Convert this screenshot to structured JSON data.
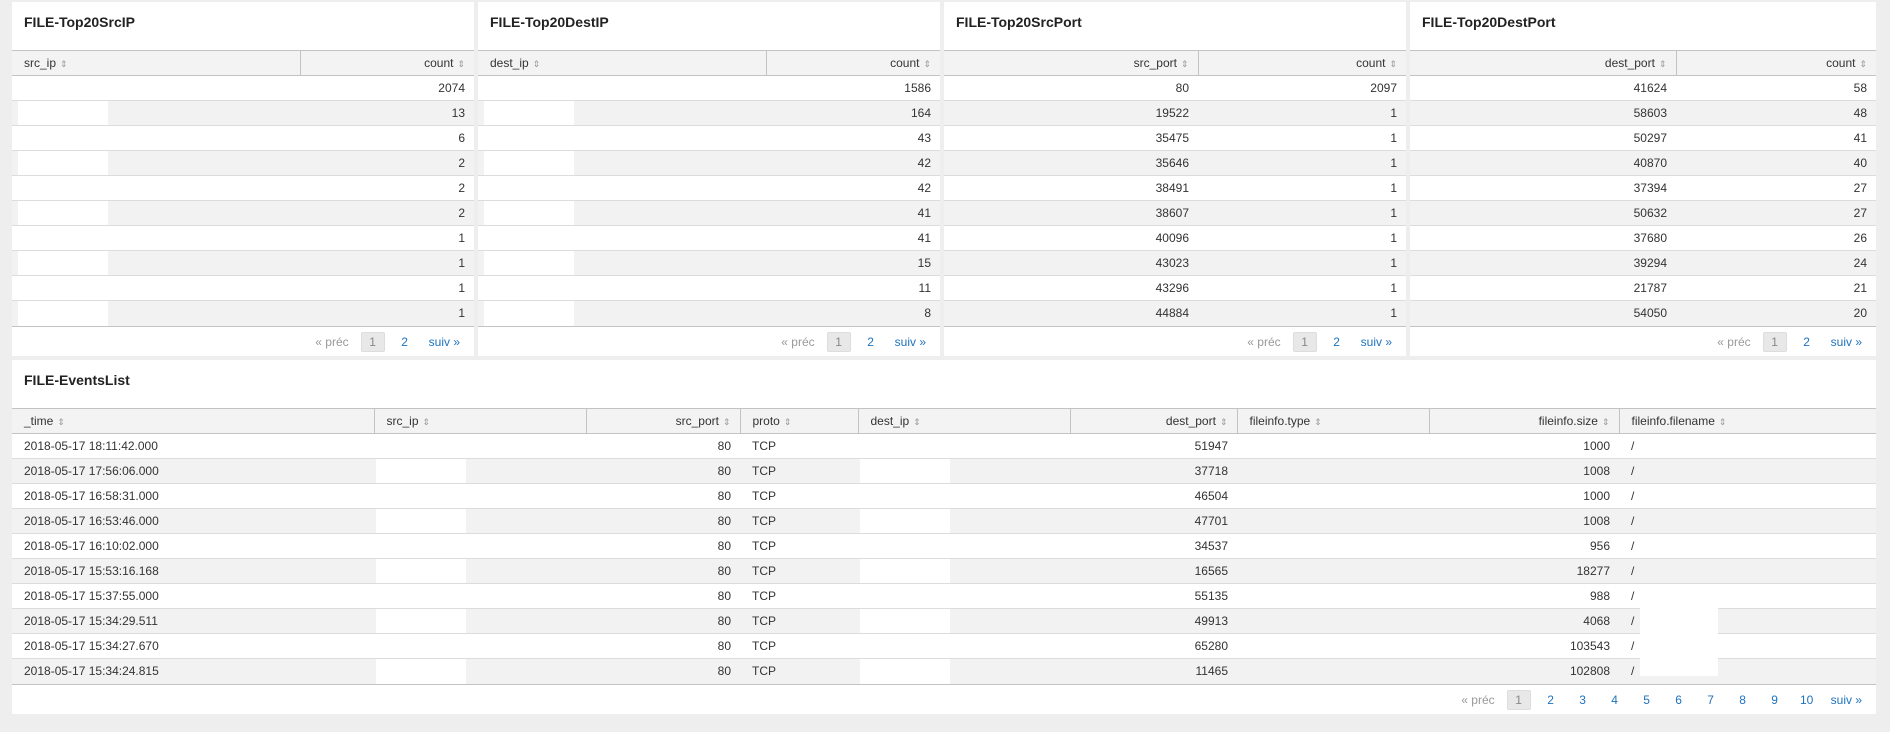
{
  "panels": {
    "srcip": {
      "title": "FILE-Top20SrcIP",
      "columns": [
        "src_ip",
        "count"
      ],
      "rows": [
        [
          "",
          "2074"
        ],
        [
          "",
          "13"
        ],
        [
          "",
          "6"
        ],
        [
          "",
          "2"
        ],
        [
          "",
          "2"
        ],
        [
          "",
          "2"
        ],
        [
          "",
          "1"
        ],
        [
          "",
          "1"
        ],
        [
          "",
          "1"
        ],
        [
          "",
          "1"
        ]
      ],
      "pager": {
        "prev": "« préc",
        "pages": [
          "1",
          "2"
        ],
        "next": "suiv »"
      }
    },
    "destip": {
      "title": "FILE-Top20DestIP",
      "columns": [
        "dest_ip",
        "count"
      ],
      "rows": [
        [
          "",
          "1586"
        ],
        [
          "",
          "164"
        ],
        [
          "",
          "43"
        ],
        [
          "",
          "42"
        ],
        [
          "",
          "42"
        ],
        [
          "",
          "41"
        ],
        [
          "",
          "41"
        ],
        [
          "",
          "15"
        ],
        [
          "",
          "11"
        ],
        [
          "",
          "8"
        ]
      ],
      "pager": {
        "prev": "« préc",
        "pages": [
          "1",
          "2"
        ],
        "next": "suiv »"
      }
    },
    "srcport": {
      "title": "FILE-Top20SrcPort",
      "columns": [
        "src_port",
        "count"
      ],
      "rows": [
        [
          "80",
          "2097"
        ],
        [
          "19522",
          "1"
        ],
        [
          "35475",
          "1"
        ],
        [
          "35646",
          "1"
        ],
        [
          "38491",
          "1"
        ],
        [
          "38607",
          "1"
        ],
        [
          "40096",
          "1"
        ],
        [
          "43023",
          "1"
        ],
        [
          "43296",
          "1"
        ],
        [
          "44884",
          "1"
        ]
      ],
      "pager": {
        "prev": "« préc",
        "pages": [
          "1",
          "2"
        ],
        "next": "suiv »"
      }
    },
    "destport": {
      "title": "FILE-Top20DestPort",
      "columns": [
        "dest_port",
        "count"
      ],
      "rows": [
        [
          "41624",
          "58"
        ],
        [
          "58603",
          "48"
        ],
        [
          "50297",
          "41"
        ],
        [
          "40870",
          "40"
        ],
        [
          "37394",
          "27"
        ],
        [
          "50632",
          "27"
        ],
        [
          "37680",
          "26"
        ],
        [
          "39294",
          "24"
        ],
        [
          "21787",
          "21"
        ],
        [
          "54050",
          "20"
        ]
      ],
      "pager": {
        "prev": "« préc",
        "pages": [
          "1",
          "2"
        ],
        "next": "suiv »"
      }
    },
    "events": {
      "title": "FILE-EventsList",
      "columns": [
        "_time",
        "src_ip",
        "src_port",
        "proto",
        "dest_ip",
        "dest_port",
        "fileinfo.type",
        "fileinfo.size",
        "fileinfo.filename"
      ],
      "rows": [
        [
          "2018-05-17 18:11:42.000",
          "",
          "80",
          "TCP",
          "",
          "51947",
          "",
          "1000",
          "/"
        ],
        [
          "2018-05-17 17:56:06.000",
          "",
          "80",
          "TCP",
          "",
          "37718",
          "",
          "1008",
          "/"
        ],
        [
          "2018-05-17 16:58:31.000",
          "",
          "80",
          "TCP",
          "",
          "46504",
          "",
          "1000",
          "/"
        ],
        [
          "2018-05-17 16:53:46.000",
          "",
          "80",
          "TCP",
          "",
          "47701",
          "",
          "1008",
          "/"
        ],
        [
          "2018-05-17 16:10:02.000",
          "",
          "80",
          "TCP",
          "",
          "34537",
          "",
          "956",
          "/"
        ],
        [
          "2018-05-17 15:53:16.168",
          "",
          "80",
          "TCP",
          "",
          "16565",
          "",
          "18277",
          "/"
        ],
        [
          "2018-05-17 15:37:55.000",
          "",
          "80",
          "TCP",
          "",
          "55135",
          "",
          "988",
          "/"
        ],
        [
          "2018-05-17 15:34:29.511",
          "",
          "80",
          "TCP",
          "",
          "49913",
          "",
          "4068",
          "/"
        ],
        [
          "2018-05-17 15:34:27.670",
          "",
          "80",
          "TCP",
          "",
          "65280",
          "",
          "103543",
          "/"
        ],
        [
          "2018-05-17 15:34:24.815",
          "",
          "80",
          "TCP",
          "",
          "11465",
          "",
          "102808",
          "/"
        ]
      ],
      "pager": {
        "prev": "« préc",
        "pages": [
          "1",
          "2",
          "3",
          "4",
          "5",
          "6",
          "7",
          "8",
          "9",
          "10"
        ],
        "next": "suiv »"
      }
    }
  },
  "sort_icon": "sort-icon",
  "colors": {
    "link": "#1e73be",
    "header_bg": "#f3f3f3",
    "stripe": "#f2f2f2",
    "page_bg": "#eeeeee"
  }
}
